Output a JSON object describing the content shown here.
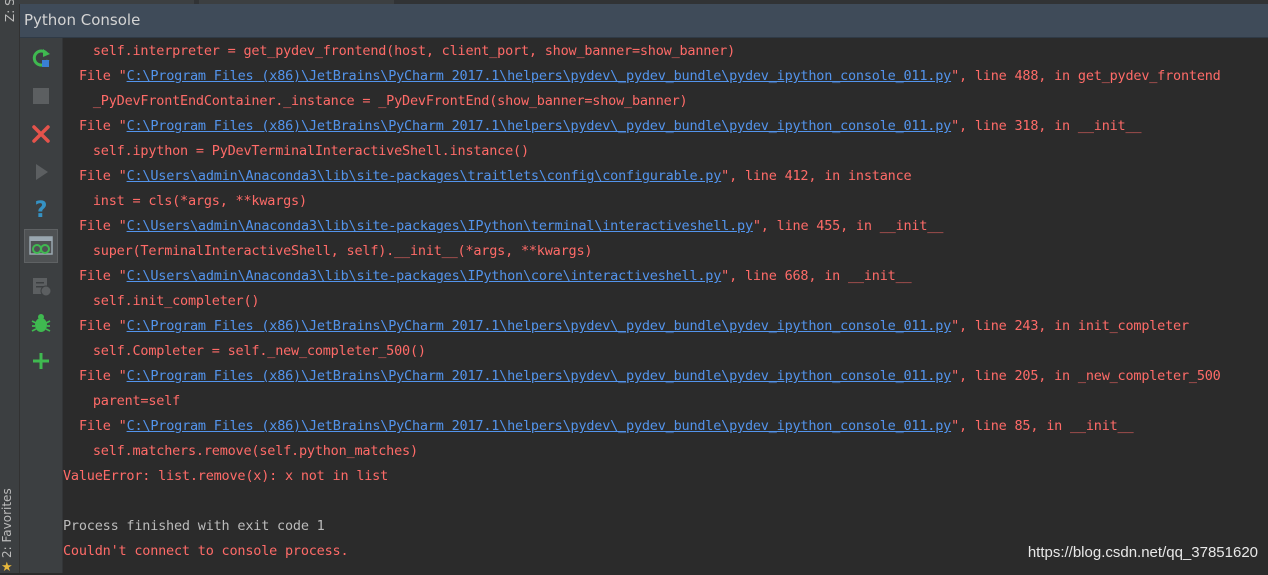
{
  "side_tabs": {
    "structure_label": "Z: Structure",
    "favorites_label": "2: Favorites"
  },
  "window": {
    "title": "Python Console"
  },
  "toolbar": {
    "rerun": "Rerun",
    "stop": "Stop",
    "close": "Close",
    "execute": "Execute",
    "help": "Help",
    "show_variables": "Show Variables",
    "history": "Console History",
    "debug": "Attach Debugger",
    "add": "New Console"
  },
  "console": {
    "line1": "  self.interpreter = get_pydev_frontend(host, client_port, show_banner=show_banner)",
    "l2_pre": "File \"",
    "l2_link": "C:\\Program Files (x86)\\JetBrains\\PyCharm 2017.1\\helpers\\pydev\\_pydev_bundle\\pydev_ipython_console_011.py",
    "l2_post": "\", line 488, in get_pydev_frontend",
    "line3": "  _PyDevFrontEndContainer._instance = _PyDevFrontEnd(show_banner=show_banner)",
    "l4_pre": "File \"",
    "l4_link": "C:\\Program Files (x86)\\JetBrains\\PyCharm 2017.1\\helpers\\pydev\\_pydev_bundle\\pydev_ipython_console_011.py",
    "l4_post": "\", line 318, in __init__",
    "line5": "  self.ipython = PyDevTerminalInteractiveShell.instance()",
    "l6_pre": "File \"",
    "l6_link": "C:\\Users\\admin\\Anaconda3\\lib\\site-packages\\traitlets\\config\\configurable.py",
    "l6_post": "\", line 412, in instance",
    "line7": "  inst = cls(*args, **kwargs)",
    "l8_pre": "File \"",
    "l8_link": "C:\\Users\\admin\\Anaconda3\\lib\\site-packages\\IPython\\terminal\\interactiveshell.py",
    "l8_post": "\", line 455, in __init__",
    "line9": "  super(TerminalInteractiveShell, self).__init__(*args, **kwargs)",
    "l10_pre": "File \"",
    "l10_link": "C:\\Users\\admin\\Anaconda3\\lib\\site-packages\\IPython\\core\\interactiveshell.py",
    "l10_post": "\", line 668, in __init__",
    "line11": "  self.init_completer()",
    "l12_pre": "File \"",
    "l12_link": "C:\\Program Files (x86)\\JetBrains\\PyCharm 2017.1\\helpers\\pydev\\_pydev_bundle\\pydev_ipython_console_011.py",
    "l12_post": "\", line 243, in init_completer",
    "line13": "  self.Completer = self._new_completer_500()",
    "l14_pre": "File \"",
    "l14_link": "C:\\Program Files (x86)\\JetBrains\\PyCharm 2017.1\\helpers\\pydev\\_pydev_bundle\\pydev_ipython_console_011.py",
    "l14_post": "\", line 205, in _new_completer_500",
    "line15": "  parent=self",
    "l16_pre": "File \"",
    "l16_link": "C:\\Program Files (x86)\\JetBrains\\PyCharm 2017.1\\helpers\\pydev\\_pydev_bundle\\pydev_ipython_console_011.py",
    "l16_post": "\", line 85, in __init__",
    "line17": "  self.matchers.remove(self.python_matches)",
    "line18": "ValueError: list.remove(x): x not in list",
    "line20": "Process finished with exit code 1",
    "line21": "Couldn't connect to console process."
  },
  "watermark": "https://blog.csdn.net/qq_37851620",
  "colors": {
    "error_text": "#ff6b68",
    "normal_text": "#bbbbbb",
    "link_text": "#5394ec",
    "title_bar": "#3f4b59",
    "background": "#2b2b2b"
  }
}
